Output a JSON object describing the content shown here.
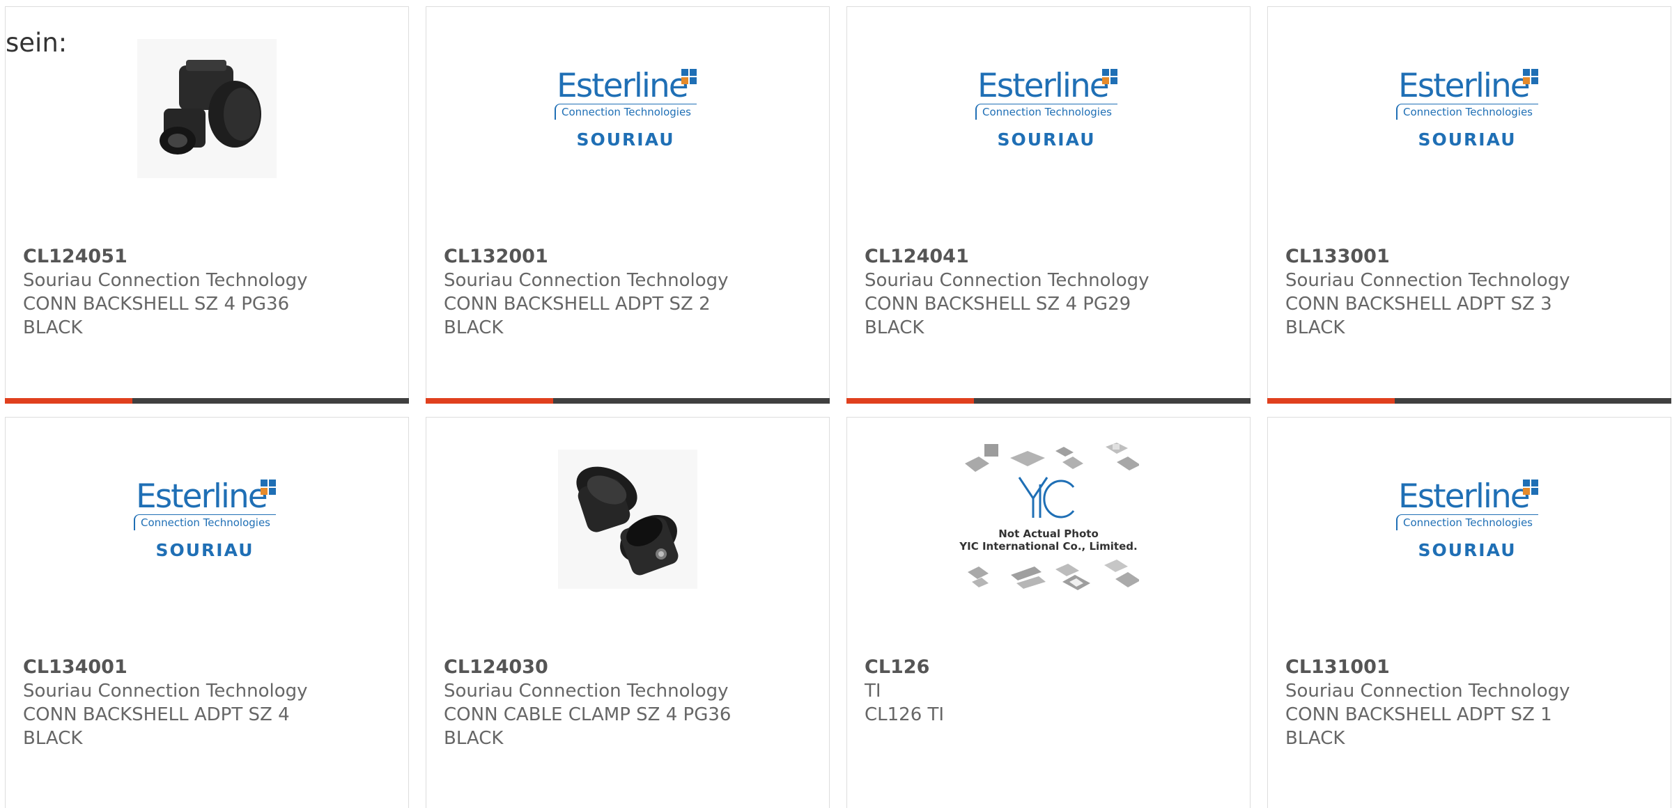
{
  "intro_text": "sein:",
  "colors": {
    "accent": "#e0401e",
    "bar": "#404040",
    "logo_blue": "#1f6fb5"
  },
  "logo": {
    "brand": "Esterline",
    "subtitle": "Connection Technologies",
    "name": "SOURIAU"
  },
  "yic_image": {
    "mark": "YIC",
    "note_line1": "Not Actual Photo",
    "note_line2": "YIC International Co., Limited."
  },
  "products": [
    {
      "part_number": "CL124051",
      "manufacturer": "Souriau Connection Technology",
      "description": "CONN BACKSHELL SZ 4 PG36 BLACK",
      "image": "right-angle-backshell-photo"
    },
    {
      "part_number": "CL132001",
      "manufacturer": "Souriau Connection Technology",
      "description": "CONN BACKSHELL ADPT SZ 2 BLACK",
      "image": "esterline-souriau-logo"
    },
    {
      "part_number": "CL124041",
      "manufacturer": "Souriau Connection Technology",
      "description": "CONN BACKSHELL SZ 4 PG29 BLACK",
      "image": "esterline-souriau-logo"
    },
    {
      "part_number": "CL133001",
      "manufacturer": "Souriau Connection Technology",
      "description": "CONN BACKSHELL ADPT SZ 3 BLACK",
      "image": "esterline-souriau-logo"
    },
    {
      "part_number": "CL134001",
      "manufacturer": "Souriau Connection Technology",
      "description": "CONN BACKSHELL ADPT SZ 4 BLACK",
      "image": "esterline-souriau-logo"
    },
    {
      "part_number": "CL124030",
      "manufacturer": "Souriau Connection Technology",
      "description": "CONN CABLE CLAMP SZ 4 PG36 BLACK",
      "image": "cable-clamp-photo"
    },
    {
      "part_number": "CL126",
      "manufacturer": "TI",
      "description": "CL126 TI",
      "image": "yic-placeholder"
    },
    {
      "part_number": "CL131001",
      "manufacturer": "Souriau Connection Technology",
      "description": "CONN BACKSHELL ADPT SZ 1 BLACK",
      "image": "esterline-souriau-logo"
    }
  ]
}
